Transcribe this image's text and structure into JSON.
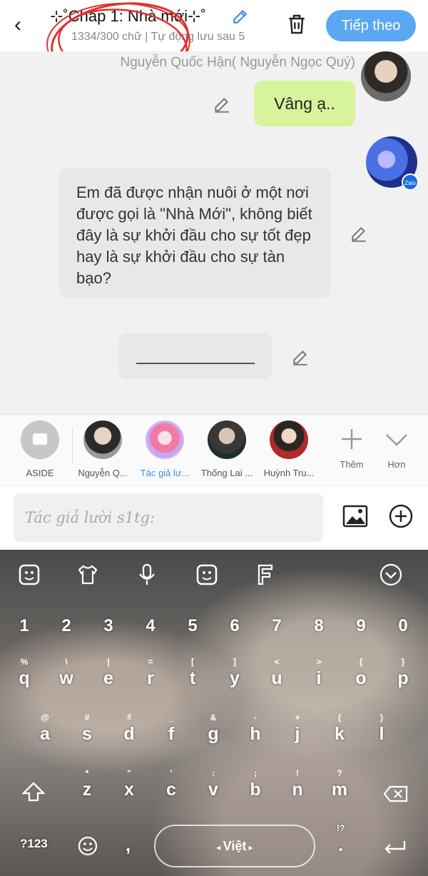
{
  "header": {
    "back_glyph": "‹",
    "title": "⊹˚Chap 1: Nhà mới⊹˚",
    "subtitle": "1334/300 chữ | Tự động lưu sau 5",
    "next_label": "Tiếp theo"
  },
  "chat": {
    "sender_name": "Nguyễn Quốc Hận( Nguyễn Ngọc Quý)",
    "my_message": "Vâng ạ..",
    "other_message": "Em đã được nhận nuôi ở một nơi được gọi là \"Nhà Mới\", không biết đây là sự khởi đầu cho sự tốt đẹp hay là sự khởi đầu cho sự tàn bạo?",
    "zalo_badge": "Zalo"
  },
  "characters": [
    {
      "name": "ASIDE"
    },
    {
      "name": "Nguyễn Q..."
    },
    {
      "name": "Tác giả lư..."
    },
    {
      "name": "Thống Lai ..."
    },
    {
      "name": "Huỳnh Tru..."
    }
  ],
  "row_actions": {
    "add_label": "Thêm",
    "more_label": "Hơn"
  },
  "input": {
    "placeholder": "Tác giả lười s1tg:"
  },
  "keyboard": {
    "number_row": [
      "1",
      "2",
      "3",
      "4",
      "5",
      "6",
      "7",
      "8",
      "9",
      "0"
    ],
    "row1": [
      {
        "hint": "%",
        "ch": "q"
      },
      {
        "hint": "\\",
        "ch": "w"
      },
      {
        "hint": "|",
        "ch": "e"
      },
      {
        "hint": "=",
        "ch": "r"
      },
      {
        "hint": "[",
        "ch": "t"
      },
      {
        "hint": "]",
        "ch": "y"
      },
      {
        "hint": "<",
        "ch": "u"
      },
      {
        "hint": ">",
        "ch": "i"
      },
      {
        "hint": "{",
        "ch": "o"
      },
      {
        "hint": "}",
        "ch": "p"
      }
    ],
    "row2": [
      {
        "hint": "@",
        "ch": "a"
      },
      {
        "hint": "#",
        "ch": "s"
      },
      {
        "hint": "₫",
        "ch": "d"
      },
      {
        "hint": "_",
        "ch": "f"
      },
      {
        "hint": "&",
        "ch": "g"
      },
      {
        "hint": "-",
        "ch": "h"
      },
      {
        "hint": "+",
        "ch": "j"
      },
      {
        "hint": "(",
        "ch": "k"
      },
      {
        "hint": ")",
        "ch": "l"
      }
    ],
    "row3": [
      {
        "hint": "*",
        "ch": "z"
      },
      {
        "hint": "\"",
        "ch": "x"
      },
      {
        "hint": "'",
        "ch": "c"
      },
      {
        "hint": ":",
        "ch": "v"
      },
      {
        "hint": ";",
        "ch": "b"
      },
      {
        "hint": "!",
        "ch": "n"
      },
      {
        "hint": "?",
        "ch": "m"
      }
    ],
    "symbols_label": "?123",
    "comma_label": ",",
    "language_label": "Việt",
    "period_label": ".",
    "period_hint": "!?"
  },
  "colors": {
    "accent_blue": "#5aa7f2",
    "my_bubble": "#d7f39b",
    "other_bubble": "#e8e8e8",
    "active_name": "#3b8fe6"
  }
}
